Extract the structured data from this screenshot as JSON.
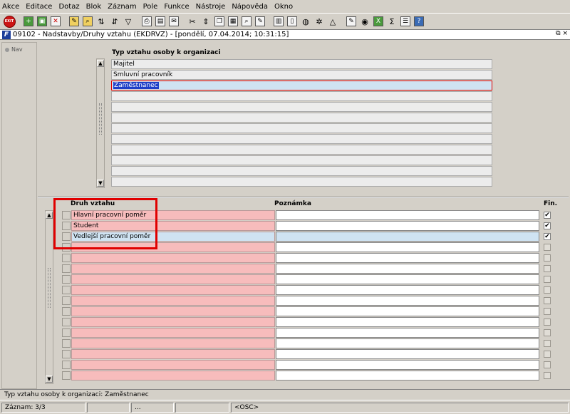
{
  "menu": [
    "Akce",
    "Editace",
    "Dotaz",
    "Blok",
    "Záznam",
    "Pole",
    "Funkce",
    "Nástroje",
    "Nápověda",
    "Okno"
  ],
  "toolbar": {
    "exit_label": "EXIT",
    "icons": [
      "save-icon",
      "print-icon",
      "clear-icon",
      "filter-icon",
      "sort-asc-icon",
      "sort-desc-icon",
      "funnel-icon",
      "printer-icon",
      "attach-icon",
      "mail-icon",
      "cut-icon",
      "paste-icon",
      "copy-icon",
      "record-icon",
      "find-icon",
      "edit-icon",
      "calc-icon",
      "doc-icon",
      "globe-icon",
      "settings-icon",
      "warning-icon",
      "note-icon",
      "disk-icon",
      "excel-icon",
      "sum-icon",
      "list-icon",
      "help-icon"
    ]
  },
  "window": {
    "logo": "F",
    "title": "09102 - Nadstavby/Druhy vztahu (EKDRVZ) - [pondělí, 07.04.2014; 10:31:15]",
    "restore_glyph": "⧉",
    "close_glyph": "×"
  },
  "nav": {
    "label": "Nav"
  },
  "upper_block": {
    "heading": "Typ vztahu osoby k organizaci",
    "rows": [
      "Majitel",
      "Smluvní pracovník",
      "Zaměstnanec",
      "",
      "",
      "",
      "",
      "",
      "",
      "",
      "",
      ""
    ],
    "selected_row": 2
  },
  "lower_block": {
    "columns": {
      "druh": "Druh vztahu",
      "poznamka": "Poznámka",
      "fin": "Fin."
    },
    "rows": [
      {
        "druh": "Hlavní pracovní poměr",
        "poznamka": "",
        "fin": true
      },
      {
        "druh": "Student",
        "poznamka": "",
        "fin": true
      },
      {
        "druh": "Vedlejší pracovní poměr",
        "poznamka": "",
        "fin": true
      },
      {
        "druh": "",
        "poznamka": "",
        "fin": false
      },
      {
        "druh": "",
        "poznamka": "",
        "fin": false
      },
      {
        "druh": "",
        "poznamka": "",
        "fin": false
      },
      {
        "druh": "",
        "poznamka": "",
        "fin": false
      },
      {
        "druh": "",
        "poznamka": "",
        "fin": false
      },
      {
        "druh": "",
        "poznamka": "",
        "fin": false
      },
      {
        "druh": "",
        "poznamka": "",
        "fin": false
      },
      {
        "druh": "",
        "poznamka": "",
        "fin": false
      },
      {
        "druh": "",
        "poznamka": "",
        "fin": false
      },
      {
        "druh": "",
        "poznamka": "",
        "fin": false
      },
      {
        "druh": "",
        "poznamka": "",
        "fin": false
      },
      {
        "druh": "",
        "poznamka": "",
        "fin": false
      },
      {
        "druh": "",
        "poznamka": "",
        "fin": false
      }
    ],
    "current_row": 2
  },
  "status": {
    "message": "Typ vztahu osoby k organizaci: Zaměstnanec",
    "record": "Záznam: 3/3",
    "cell2": "",
    "cell3": "...",
    "cell4": "",
    "mode": "<OSC>"
  },
  "colors": {
    "selection_border": "#e00000",
    "highlight_bg": "#1e3fc8",
    "pink_field": "#f7bcbc",
    "current_row_bg": "#cfe3f2"
  }
}
